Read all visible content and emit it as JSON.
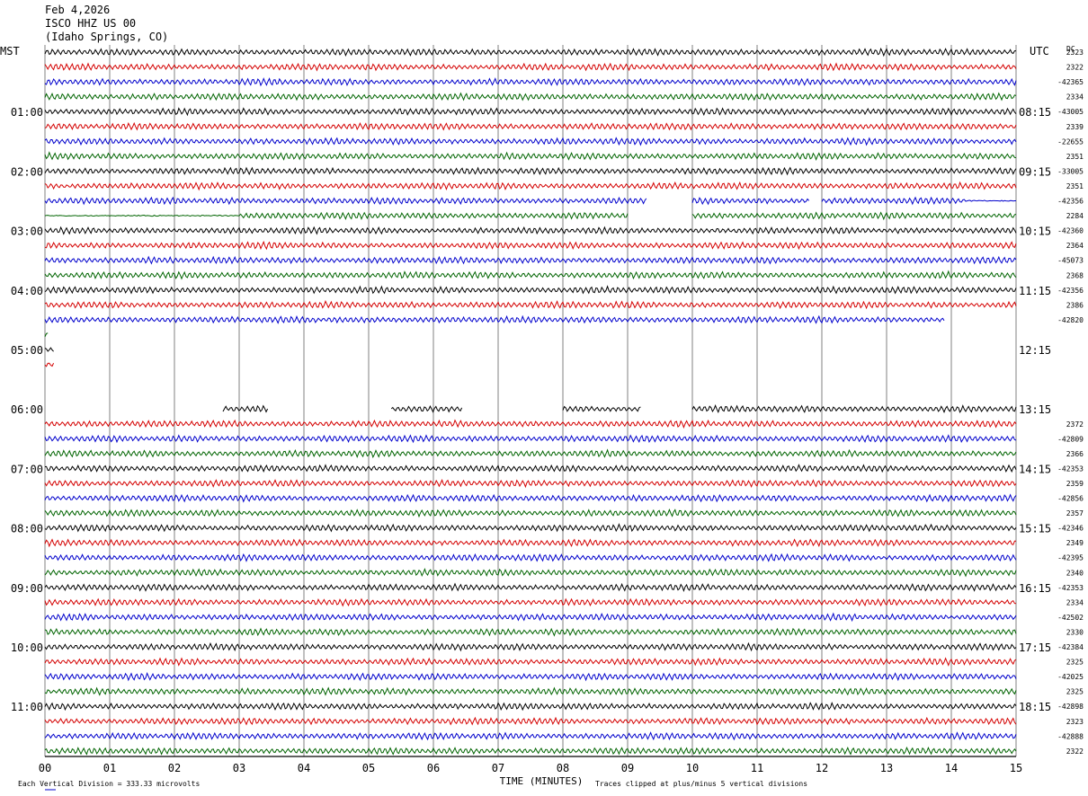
{
  "header": {
    "date": "Feb 4,2026",
    "station": "ISCO HHZ US 00",
    "location": "(Idaho Springs, CO)"
  },
  "left_axis_label": "MST",
  "right_axis_label": "UTC",
  "dc_label": "DC",
  "x_axis_title": "TIME (MINUTES)",
  "footer": {
    "division_note": "Each Vertical Division =  333.33 microvolts",
    "clip_note": "Traces clipped at plus/minus 5 vertical divisions"
  },
  "colors": {
    "black": "#000000",
    "red": "#d40000",
    "blue": "#0000cc",
    "green": "#006400",
    "grid": "#808080"
  },
  "chart_data": {
    "type": "line",
    "description_units": "helicorder: 48 trace rows of 15 minutes each, 4 rows per hour",
    "x_ticks": [
      "00",
      "01",
      "02",
      "03",
      "04",
      "05",
      "06",
      "07",
      "08",
      "09",
      "10",
      "11",
      "12",
      "13",
      "14",
      "15"
    ],
    "xlim": [
      0,
      15
    ],
    "left_hour_labels": [
      {
        "row": 4,
        "label": "01:00"
      },
      {
        "row": 8,
        "label": "02:00"
      },
      {
        "row": 12,
        "label": "03:00"
      },
      {
        "row": 16,
        "label": "04:00"
      },
      {
        "row": 20,
        "label": "05:00"
      },
      {
        "row": 24,
        "label": "06:00"
      },
      {
        "row": 28,
        "label": "07:00"
      },
      {
        "row": 32,
        "label": "08:00"
      },
      {
        "row": 36,
        "label": "09:00"
      },
      {
        "row": 40,
        "label": "10:00"
      },
      {
        "row": 44,
        "label": "11:00"
      }
    ],
    "right_hour_labels": [
      {
        "row": 4,
        "label": "08:15"
      },
      {
        "row": 8,
        "label": "09:15"
      },
      {
        "row": 12,
        "label": "10:15"
      },
      {
        "row": 16,
        "label": "11:15"
      },
      {
        "row": 20,
        "label": "12:15"
      },
      {
        "row": 24,
        "label": "13:15"
      },
      {
        "row": 28,
        "label": "14:15"
      },
      {
        "row": 32,
        "label": "15:15"
      },
      {
        "row": 36,
        "label": "16:15"
      },
      {
        "row": 40,
        "label": "17:15"
      },
      {
        "row": 44,
        "label": "18:15"
      }
    ],
    "dc_offsets": [
      "2323",
      "2322",
      "-42365",
      "2334",
      "-43005",
      "2339",
      "-22655",
      "2351",
      "-33005",
      "2351",
      "-42356",
      "2284",
      "-42360",
      "2364",
      "-45073",
      "2368",
      "-42356",
      "2386",
      "-42820",
      "",
      "",
      "",
      "",
      "",
      "",
      "2372",
      "-42809",
      "2366",
      "-42353",
      "2359",
      "-42856",
      "2357",
      "-42346",
      "2349",
      "-42395",
      "2340",
      "-42353",
      "2334",
      "-42502",
      "2330",
      "-42384",
      "2325",
      "-42025",
      "2325",
      "-42898",
      "2323",
      "-42888",
      "2322"
    ],
    "row_color_cycle": [
      "black",
      "red",
      "blue",
      "green"
    ],
    "trace_segments": [
      {
        "row": 10,
        "segments": [
          [
            0,
            9.3
          ],
          [
            10.0,
            11.8
          ],
          [
            12.0,
            15
          ]
        ],
        "flat_after": 14.2
      },
      {
        "row": 11,
        "segments": [
          [
            0,
            9.0
          ],
          [
            10.0,
            15
          ]
        ],
        "flat_before": 3.0
      },
      {
        "row": 18,
        "segments": [
          [
            0,
            13.9
          ]
        ]
      },
      {
        "row": 19,
        "segments": [
          [
            0,
            0.05
          ]
        ]
      },
      {
        "row": 20,
        "segments": [
          [
            0,
            0.15
          ]
        ]
      },
      {
        "row": 21,
        "segments": [
          [
            0,
            0.15
          ]
        ]
      },
      {
        "row": 22,
        "segments": []
      },
      {
        "row": 23,
        "segments": []
      },
      {
        "row": 24,
        "segments": [
          [
            2.75,
            3.45
          ],
          [
            5.35,
            6.45
          ],
          [
            8.0,
            9.2
          ],
          [
            10.0,
            15
          ]
        ]
      }
    ],
    "grid": true
  }
}
